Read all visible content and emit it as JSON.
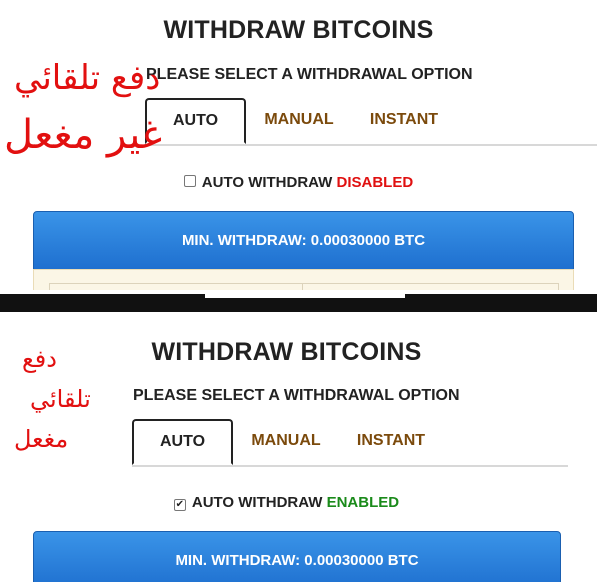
{
  "top": {
    "title": "WITHDRAW BITCOINS",
    "subtitle": "PLEASE SELECT A WITHDRAWAL OPTION",
    "tabs": [
      "AUTO",
      "MANUAL",
      "INSTANT"
    ],
    "auto_withdraw_label": "AUTO WITHDRAW",
    "auto_withdraw_status": "DISABLED",
    "auto_withdraw_checked": false,
    "min_withdraw": "MIN. WITHDRAW: 0.00030000 BTC",
    "annotation_line1": "دفع تلقائي",
    "annotation_line2": "غير مغعل"
  },
  "bottom": {
    "title": "WITHDRAW BITCOINS",
    "subtitle": "PLEASE SELECT A WITHDRAWAL OPTION",
    "tabs": [
      "AUTO",
      "MANUAL",
      "INSTANT"
    ],
    "auto_withdraw_label": "AUTO WITHDRAW",
    "auto_withdraw_status": "ENABLED",
    "auto_withdraw_checked": true,
    "min_withdraw": "MIN. WITHDRAW: 0.00030000 BTC",
    "annotation_line1": "دفع",
    "annotation_line2": "تلقائي",
    "annotation_line3": "مغعل"
  },
  "colors": {
    "tab_inactive": "#7b4a0c",
    "disabled": "#e01010",
    "enabled": "#1a8a1a",
    "button_blue": "#1e6fcf",
    "annotation_red": "#e21010"
  }
}
